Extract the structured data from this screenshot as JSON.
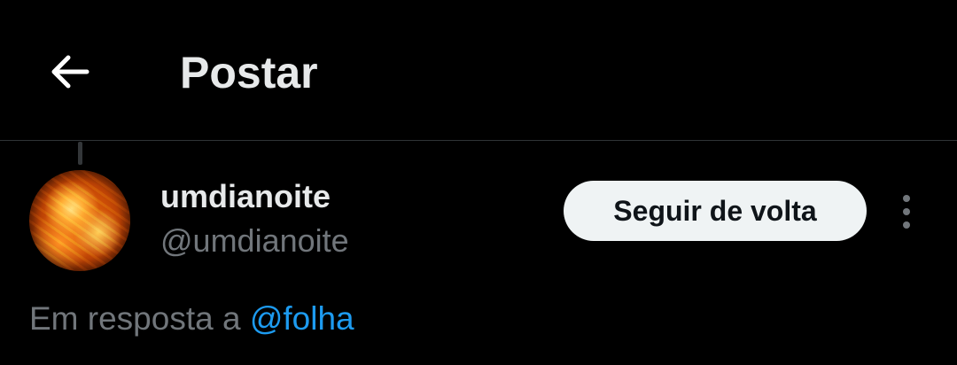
{
  "header": {
    "back_icon": "arrow-left-icon",
    "title": "Postar"
  },
  "post": {
    "author": {
      "display_name": "umdianoite",
      "handle": "@umdianoite",
      "avatar": "sun-surface-avatar"
    },
    "follow_button_label": "Seguir de volta",
    "more_icon": "more-vertical-icon",
    "reply_prefix": "Em resposta a",
    "reply_to": "@folha"
  },
  "colors": {
    "background": "#000000",
    "text_primary": "#e7e9ea",
    "text_secondary": "#71767b",
    "link": "#1d9bf0",
    "divider": "#2f3336",
    "button_bg": "#eff3f4",
    "button_text": "#0f1419"
  }
}
